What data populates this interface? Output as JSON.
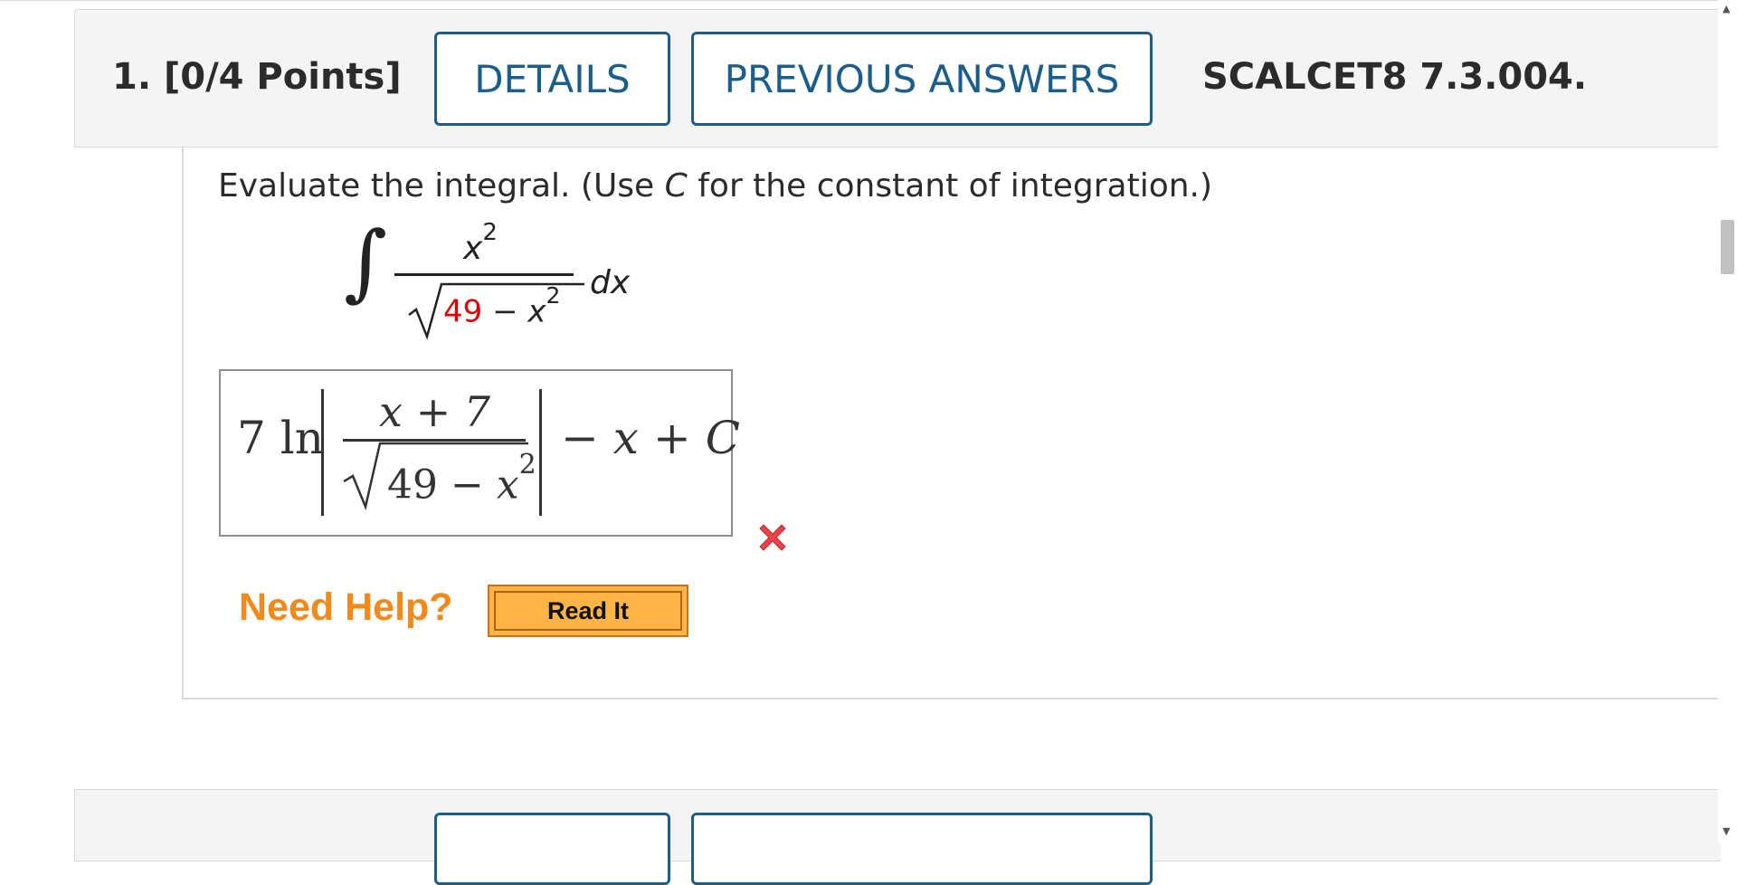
{
  "question": {
    "number_points": "1.  [0/4 Points]",
    "details_label": "DETAILS",
    "previous_answers_label": "PREVIOUS ANSWERS",
    "code": "SCALCET8 7.3.004."
  },
  "prompt": {
    "before": "Evaluate the integral. (Use ",
    "constant": "C",
    "after": " for the constant of integration.)"
  },
  "integral": {
    "sign": "∫",
    "numerator_var": "x",
    "numerator_exp": "2",
    "radicand_const": "49",
    "radicand_op": " − ",
    "radicand_var": "x",
    "radicand_exp": "2",
    "differential": "dx"
  },
  "answer": {
    "coefficient": "7 ln",
    "numerator": "x + 7",
    "radicand": "49 − ",
    "radicand_var": "x",
    "radicand_exp": "2",
    "tail_op": "− ",
    "tail_var": "x",
    "tail_rest": " + ",
    "tail_const": "C",
    "status": "incorrect",
    "status_icon": "red-x-icon",
    "status_color": "#e8434a"
  },
  "help": {
    "label": "Need Help?",
    "read_it_label": "Read It",
    "label_color": "#f28a1b",
    "button_color": "#fdb446"
  },
  "colors": {
    "accent": "#1b5e8c",
    "radicand_highlight": "#e00000"
  }
}
